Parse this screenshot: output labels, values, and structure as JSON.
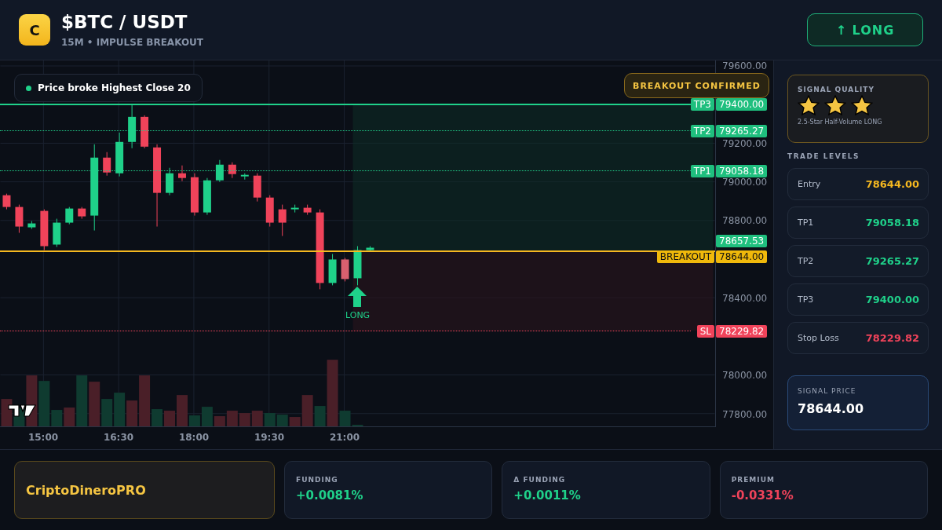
{
  "header": {
    "logo_letter": "C",
    "title": "$BTC / USDT",
    "subtitle": "15M • IMPULSE BREAKOUT",
    "direction_button": "↑ LONG"
  },
  "chart": {
    "legend": "Price broke Highest Close 20",
    "badge": "BREAKOUT CONFIRMED",
    "y_ticks": [
      "79600.00",
      "79200.00",
      "79000.00",
      "78800.00",
      "78400.00",
      "78000.00",
      "77800.00"
    ],
    "x_ticks": [
      "15:00",
      "16:30",
      "18:00",
      "19:30",
      "21:00"
    ],
    "price_tags": [
      {
        "kind": "tp",
        "label": "TP3",
        "value": "79400.00",
        "dotted": false
      },
      {
        "kind": "tp",
        "label": "TP2",
        "value": "79265.27",
        "dotted": true
      },
      {
        "kind": "tp",
        "label": "TP1",
        "value": "79058.18",
        "dotted": true
      },
      {
        "kind": "current",
        "value": "78657.53"
      },
      {
        "kind": "entry",
        "label": "BREAKOUT",
        "value": "78644.00",
        "dotted": false
      },
      {
        "kind": "sl",
        "label": "SL",
        "value": "78229.82",
        "dotted": true
      }
    ],
    "signal_marker": "LONG"
  },
  "sidebar": {
    "signal_quality": {
      "title": "SIGNAL QUALITY",
      "stars": 3,
      "caption": "2.5-Star Half-Volume LONG"
    },
    "levels_title": "TRADE LEVELS",
    "levels": [
      {
        "label": "Entry",
        "value": "78644.00",
        "color": "#f5b820"
      },
      {
        "label": "TP1",
        "value": "79058.18",
        "color": "#1fd18a"
      },
      {
        "label": "TP2",
        "value": "79265.27",
        "color": "#1fd18a"
      },
      {
        "label": "TP3",
        "value": "79400.00",
        "color": "#1fd18a"
      },
      {
        "label": "Stop Loss",
        "value": "78229.82",
        "color": "#f0435a"
      }
    ],
    "signal_price": {
      "label": "SIGNAL PRICE",
      "value": "78644.00"
    }
  },
  "footer": {
    "brand": "CriptoDineroPRO",
    "metrics": [
      {
        "label": "FUNDING",
        "value": "+0.0081%",
        "color": "#1fd18a"
      },
      {
        "label": "Δ FUNDING",
        "value": "+0.0011%",
        "color": "#1fd18a"
      },
      {
        "label": "PREMIUM",
        "value": "-0.0331%",
        "color": "#f0435a"
      }
    ]
  }
}
